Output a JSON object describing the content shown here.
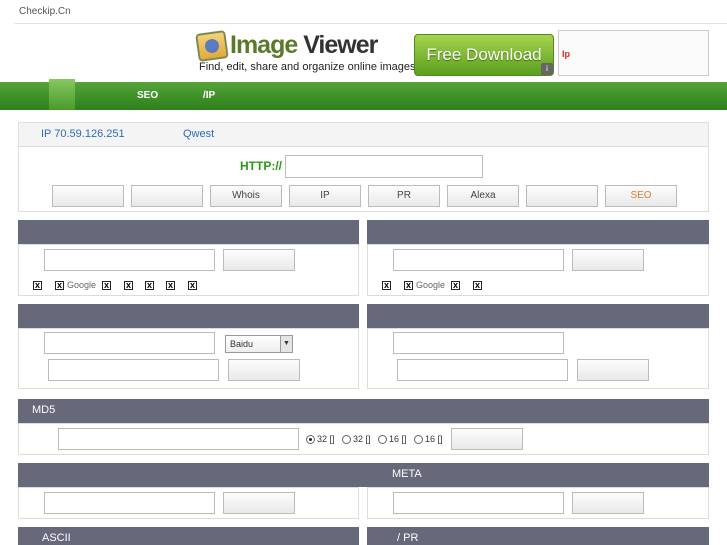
{
  "site": {
    "name": "Checkip.Cn"
  },
  "ad": {
    "title_part1": "Image",
    "title_part2": " Viewer",
    "subtitle": "Find, edit, share and organize online images.",
    "download_label": "Free Download",
    "info_icon": "info-icon"
  },
  "ip_box": {
    "label": "Ip"
  },
  "nav": {
    "items": [
      "SEO",
      "/IP"
    ]
  },
  "info": {
    "ip": "IP  70.59.126.251",
    "isp": "Qwest"
  },
  "query": {
    "http_label": "HTTP://",
    "input_value": "",
    "buttons": [
      "",
      "",
      "Whois",
      "IP",
      "PR",
      "Alexa",
      "",
      "SEO"
    ]
  },
  "sections": {
    "s1": {
      "title": "",
      "checkbox_label": "Google"
    },
    "s2": {
      "title": "",
      "checkbox_label": "Google"
    },
    "s3": {
      "title": "",
      "engine": "Baidu"
    },
    "s4": {
      "title": ""
    },
    "md5": {
      "title": "MD5",
      "options": [
        "32 []",
        "32 []",
        "16 []",
        "16 []"
      ],
      "selected_index": 0
    },
    "meta": {
      "title": "META"
    },
    "ascii": {
      "title": "ASCII"
    },
    "pr": {
      "title": "/ PR"
    }
  },
  "colors": {
    "nav_green": "#3f8f27",
    "section_header": "#66697a",
    "http_green": "#2a9a16",
    "info_blue": "#2a6cc0",
    "seo_orange": "#e07a2e"
  }
}
